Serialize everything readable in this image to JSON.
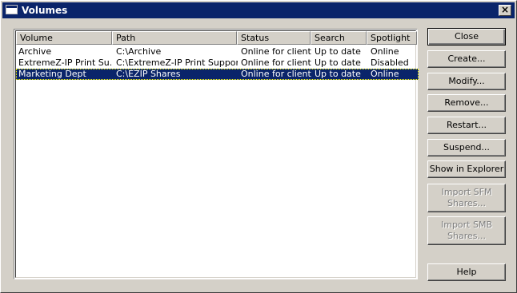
{
  "window": {
    "title": "Volumes",
    "close_glyph": "×"
  },
  "list": {
    "columns": [
      "Volume",
      "Path",
      "Status",
      "Search",
      "Spotlight"
    ],
    "rows": [
      {
        "volume": "Archive",
        "path": "C:\\Archive",
        "status": "Online for clients",
        "search": "Up to date",
        "spotlight": "Online"
      },
      {
        "volume": "ExtremeZ-IP Print Su...",
        "path": "C:\\ExtremeZ-IP Print Support",
        "status": "Online for clients",
        "search": "Up to date",
        "spotlight": "Disabled"
      },
      {
        "volume": "Marketing Dept",
        "path": "C:\\EZIP Shares",
        "status": "Online for clients",
        "search": "Up to date",
        "spotlight": "Online"
      }
    ],
    "selected_index": 2
  },
  "buttons": {
    "close": "Close",
    "create": "Create...",
    "modify": "Modify...",
    "remove": "Remove...",
    "restart": "Restart...",
    "suspend": "Suspend...",
    "show_in_explorer": "Show in Explorer",
    "import_sfm_line1": "Import SFM",
    "import_sfm_line2": "Shares...",
    "import_smb_line1": "Import SMB",
    "import_smb_line2": "Shares...",
    "help": "Help"
  },
  "colors": {
    "titlebar": "#0a246a",
    "selection": "#0a246a",
    "face": "#d4d0c8"
  },
  "icons": {
    "window_icon": "window-icon",
    "close_icon": "close-icon"
  }
}
